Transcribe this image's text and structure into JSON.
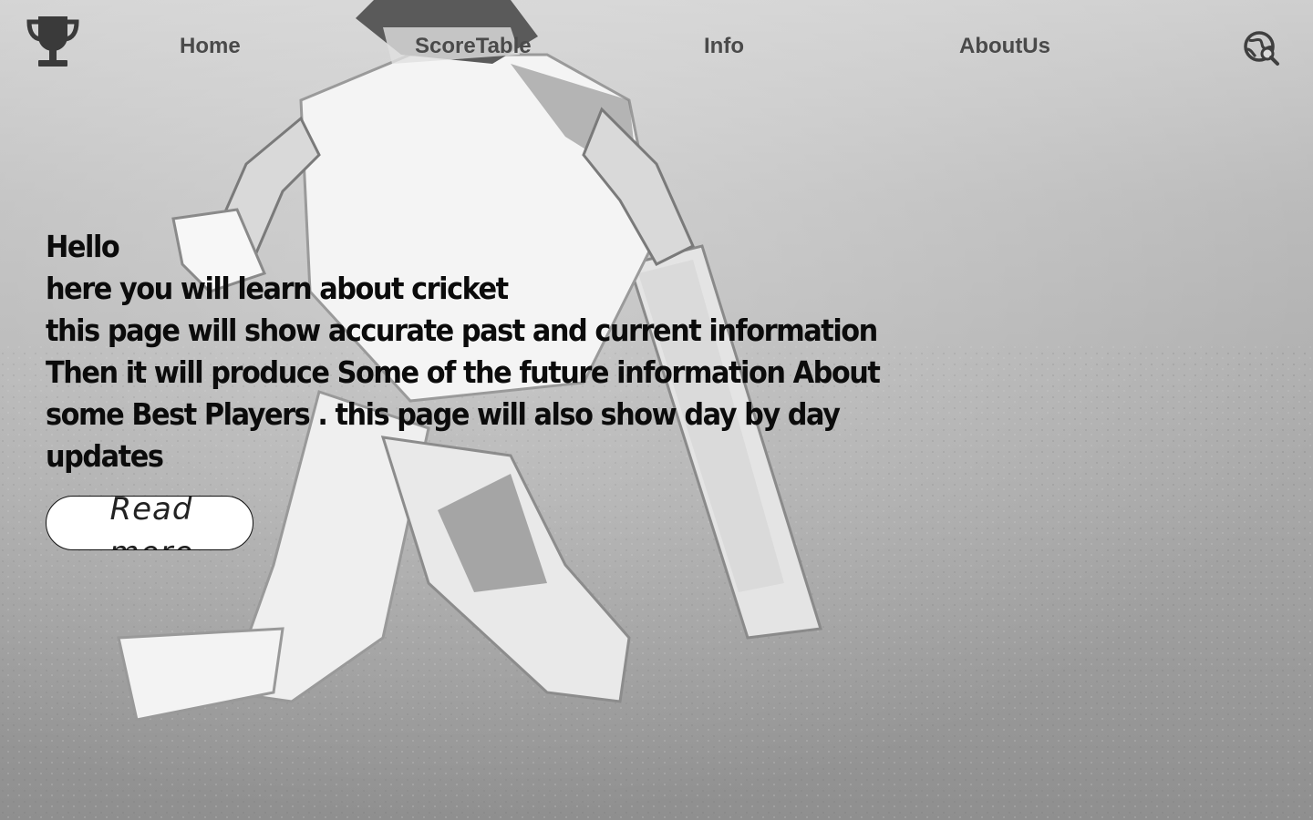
{
  "nav": {
    "links": [
      {
        "label": "Home"
      },
      {
        "label": "ScoreTable"
      },
      {
        "label": "Info"
      },
      {
        "label": "AboutUs"
      }
    ],
    "logo_icon": "trophy-icon",
    "search_icon": "globe-search-icon"
  },
  "hero": {
    "lines": [
      "Hello",
      "here you will  learn about cricket",
      "this page will show accurate past and current information",
      "Then it will produce Some of the future information About",
      "some Best Players . this page will also show day by day",
      "updates"
    ],
    "button_label": "Read more",
    "background": "cricket-batsman-running-photo"
  },
  "colors": {
    "nav_text": "#4a4a4a",
    "heading_text": "#0b0b0b",
    "button_bg": "#ffffff",
    "photo_tint": "#9a9a9a"
  }
}
